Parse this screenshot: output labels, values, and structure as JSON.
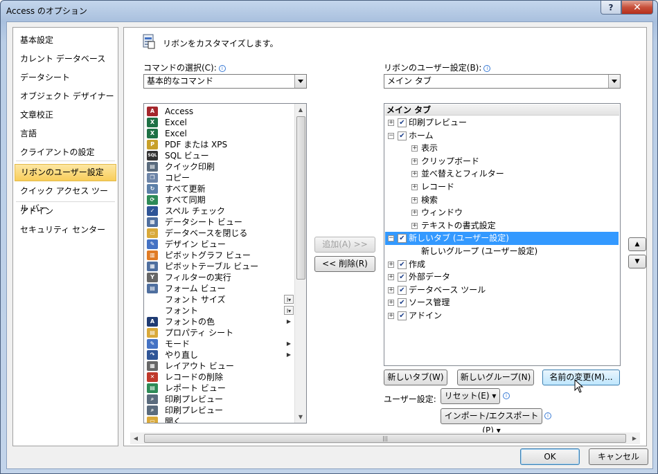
{
  "window": {
    "title": "Access のオプション",
    "help_glyph": "?",
    "close_glyph": "✕"
  },
  "nav": {
    "items": [
      "基本設定",
      "カレント データベース",
      "データシート",
      "オブジェクト デザイナー",
      "文章校正",
      "言語",
      "クライアントの設定",
      "リボンのユーザー設定",
      "クイック アクセス ツール バー",
      "アドイン",
      "セキュリティ センター"
    ],
    "selected": 7
  },
  "heading": "リボンをカスタマイズします。",
  "left": {
    "label": "コマンドの選択(C):",
    "combo_value": "基本的なコマンド",
    "commands": [
      {
        "text": "Access",
        "icon": "access-icon",
        "color": "#a4262c",
        "glyph": "A"
      },
      {
        "text": "Excel",
        "icon": "excel-icon",
        "color": "#1e7145",
        "glyph": "X"
      },
      {
        "text": "Excel",
        "icon": "excel-icon",
        "color": "#1e7145",
        "glyph": "X"
      },
      {
        "text": "PDF または XPS",
        "icon": "pdf-icon",
        "color": "#c8a02a",
        "glyph": "P"
      },
      {
        "text": "SQL ビュー",
        "icon": "sql-icon",
        "color": "#333333",
        "glyph": "SQL"
      },
      {
        "text": "クイック印刷",
        "icon": "printer-icon",
        "color": "#5a6b7d",
        "glyph": "▤"
      },
      {
        "text": "コピー",
        "icon": "copy-icon",
        "color": "#6d85a8",
        "glyph": "❐"
      },
      {
        "text": "すべて更新",
        "icon": "refresh-icon",
        "color": "#5b7fa8",
        "glyph": "↻"
      },
      {
        "text": "すべて同期",
        "icon": "sync-icon",
        "color": "#2e8b57",
        "glyph": "⟳"
      },
      {
        "text": "スペル チェック",
        "icon": "spelling-icon",
        "color": "#2f5597",
        "glyph": "✓"
      },
      {
        "text": "データシート ビュー",
        "icon": "datasheet-icon",
        "color": "#4f6f9f",
        "glyph": "▦"
      },
      {
        "text": "データベースを閉じる",
        "icon": "folder-close-icon",
        "color": "#d9a93a",
        "glyph": "▭"
      },
      {
        "text": "デザイン ビュー",
        "icon": "design-icon",
        "color": "#4472c4",
        "glyph": "✎"
      },
      {
        "text": "ピボットグラフ ビュー",
        "icon": "pivotchart-icon",
        "color": "#e07b24",
        "glyph": "▥"
      },
      {
        "text": "ピボットテーブル ビュー",
        "icon": "pivottable-icon",
        "color": "#4f6f9f",
        "glyph": "▦"
      },
      {
        "text": "フィルターの実行",
        "icon": "filter-icon",
        "color": "#666666",
        "glyph": "Y"
      },
      {
        "text": "フォーム ビュー",
        "icon": "form-icon",
        "color": "#4f6f9f",
        "glyph": "▤"
      },
      {
        "text": "フォント サイズ",
        "icon": "",
        "color": "",
        "glyph": "",
        "sub": "I▾"
      },
      {
        "text": "フォント",
        "icon": "",
        "color": "",
        "glyph": "",
        "sub": "I▾"
      },
      {
        "text": "フォントの色",
        "icon": "font-color-icon",
        "color": "#1f3b73",
        "glyph": "A",
        "sub": "▶"
      },
      {
        "text": "プロパティ シート",
        "icon": "property-sheet-icon",
        "color": "#d9a93a",
        "glyph": "▤"
      },
      {
        "text": "モード",
        "icon": "mode-icon",
        "color": "#4472c4",
        "glyph": "✎",
        "sub": "▶"
      },
      {
        "text": "やり直し",
        "icon": "redo-icon",
        "color": "#2f5597",
        "glyph": "↷",
        "sub": "▶"
      },
      {
        "text": "レイアウト ビュー",
        "icon": "layout-icon",
        "color": "#666666",
        "glyph": "▦"
      },
      {
        "text": "レコードの削除",
        "icon": "delete-record-icon",
        "color": "#c0392b",
        "glyph": "✕"
      },
      {
        "text": "レポート ビュー",
        "icon": "report-icon",
        "color": "#2e8b57",
        "glyph": "▤"
      },
      {
        "text": "印刷プレビュー",
        "icon": "print-preview-icon",
        "color": "#5a6b7d",
        "glyph": "⌕"
      },
      {
        "text": "印刷プレビュー",
        "icon": "print-preview-icon",
        "color": "#5a6b7d",
        "glyph": "⌕"
      },
      {
        "text": "開く",
        "icon": "open-icon",
        "color": "#d9a93a",
        "glyph": "▭"
      }
    ]
  },
  "mid": {
    "add": "追加(A) >>",
    "remove": "<< 削除(R)"
  },
  "right": {
    "label": "リボンのユーザー設定(B):",
    "combo_value": "メイン タブ",
    "tree_header": "メイン タブ",
    "tree": [
      {
        "text": "印刷プレビュー",
        "level": 0,
        "exp": "+",
        "checked": true
      },
      {
        "text": "ホーム",
        "level": 0,
        "exp": "−",
        "checked": true
      },
      {
        "text": "表示",
        "level": 1,
        "exp": "+"
      },
      {
        "text": "クリップボード",
        "level": 1,
        "exp": "+"
      },
      {
        "text": "並べ替えとフィルター",
        "level": 1,
        "exp": "+"
      },
      {
        "text": "レコード",
        "level": 1,
        "exp": "+"
      },
      {
        "text": "検索",
        "level": 1,
        "exp": "+"
      },
      {
        "text": "ウィンドウ",
        "level": 1,
        "exp": "+"
      },
      {
        "text": "テキストの書式設定",
        "level": 1,
        "exp": "+"
      },
      {
        "text": "新しいタブ (ユーザー設定)",
        "level": 0,
        "exp": "−",
        "checked": true,
        "selected": true
      },
      {
        "text": "新しいグループ (ユーザー設定)",
        "level": 2
      },
      {
        "text": "作成",
        "level": 0,
        "exp": "+",
        "checked": true
      },
      {
        "text": "外部データ",
        "level": 0,
        "exp": "+",
        "checked": true
      },
      {
        "text": "データベース ツール",
        "level": 0,
        "exp": "+",
        "checked": true
      },
      {
        "text": "ソース管理",
        "level": 0,
        "exp": "+",
        "checked": true
      },
      {
        "text": "アドイン",
        "level": 0,
        "exp": "+",
        "checked": true
      }
    ],
    "new_tab": "新しいタブ(W)",
    "new_group": "新しいグループ(N)",
    "rename": "名前の変更(M)...",
    "custom_label": "ユーザー設定:",
    "reset": "リセット(E) ▾",
    "import_export": "インポート/エクスポート(P) ▾"
  },
  "footer": {
    "ok": "OK",
    "cancel": "キャンセル"
  }
}
